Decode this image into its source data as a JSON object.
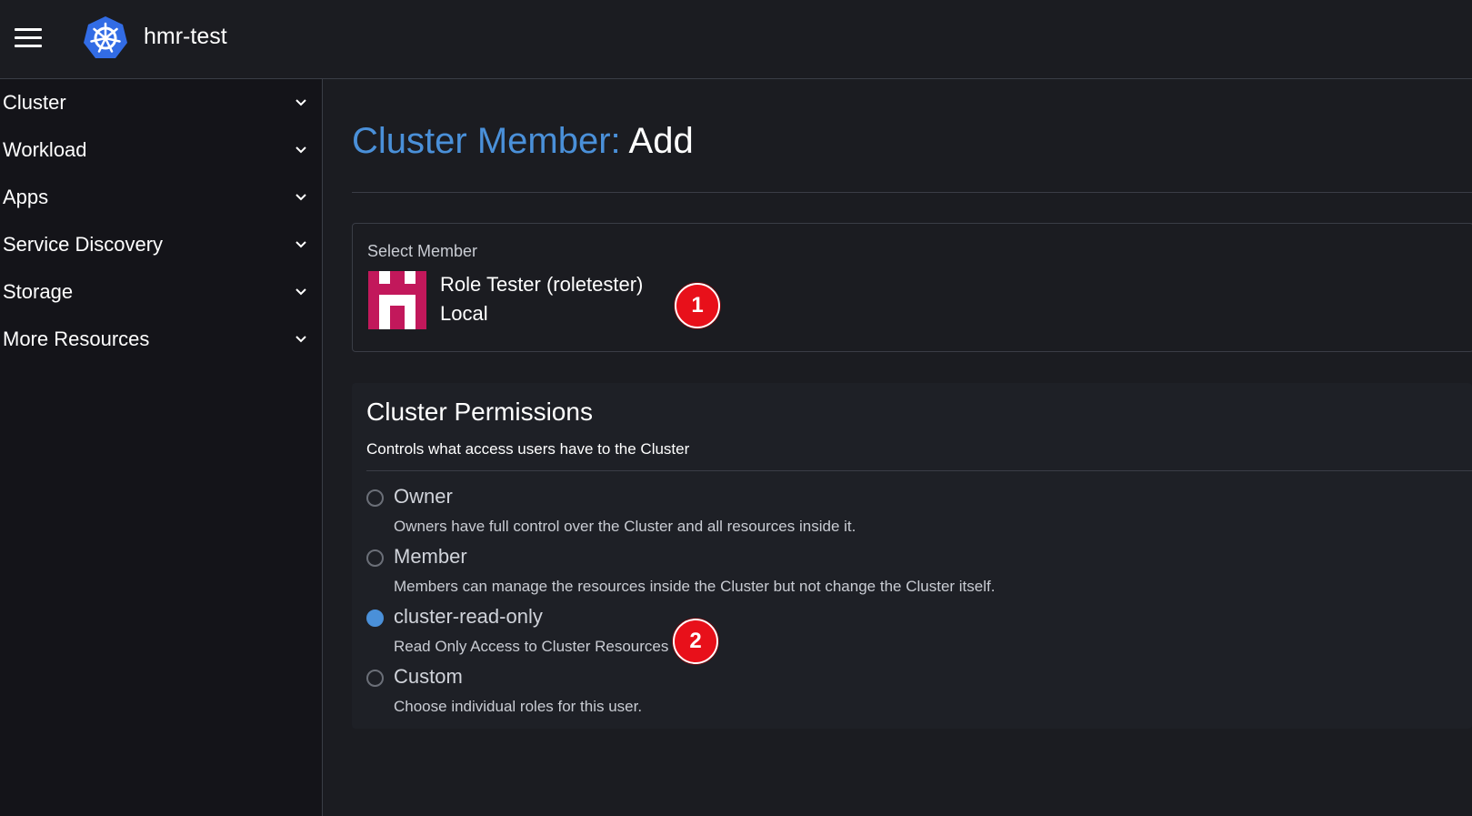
{
  "header": {
    "cluster_name": "hmr-test",
    "logo_icon": "kubernetes-helm-icon"
  },
  "sidebar": {
    "items": [
      {
        "label": "Cluster"
      },
      {
        "label": "Workload"
      },
      {
        "label": "Apps"
      },
      {
        "label": "Service Discovery"
      },
      {
        "label": "Storage"
      },
      {
        "label": "More Resources"
      }
    ]
  },
  "page": {
    "title_prefix": "Cluster Member:",
    "title_suffix": "Add"
  },
  "member": {
    "section_label": "Select Member",
    "name": "Role Tester (roletester)",
    "provider": "Local"
  },
  "permissions": {
    "title": "Cluster Permissions",
    "subtitle": "Controls what access users have to the Cluster",
    "options": [
      {
        "label": "Owner",
        "description": "Owners have full control over the Cluster and all resources inside it.",
        "selected": false
      },
      {
        "label": "Member",
        "description": "Members can manage the resources inside the Cluster but not change the Cluster itself.",
        "selected": false
      },
      {
        "label": "cluster-read-only",
        "description": "Read Only Access to Cluster Resources",
        "selected": true
      },
      {
        "label": "Custom",
        "description": "Choose individual roles for this user.",
        "selected": false
      }
    ]
  },
  "annotations": {
    "badge1": "1",
    "badge2": "2"
  },
  "colors": {
    "accent": "#4a90d9",
    "badge": "#e8101a",
    "avatar": "#c2185b"
  }
}
